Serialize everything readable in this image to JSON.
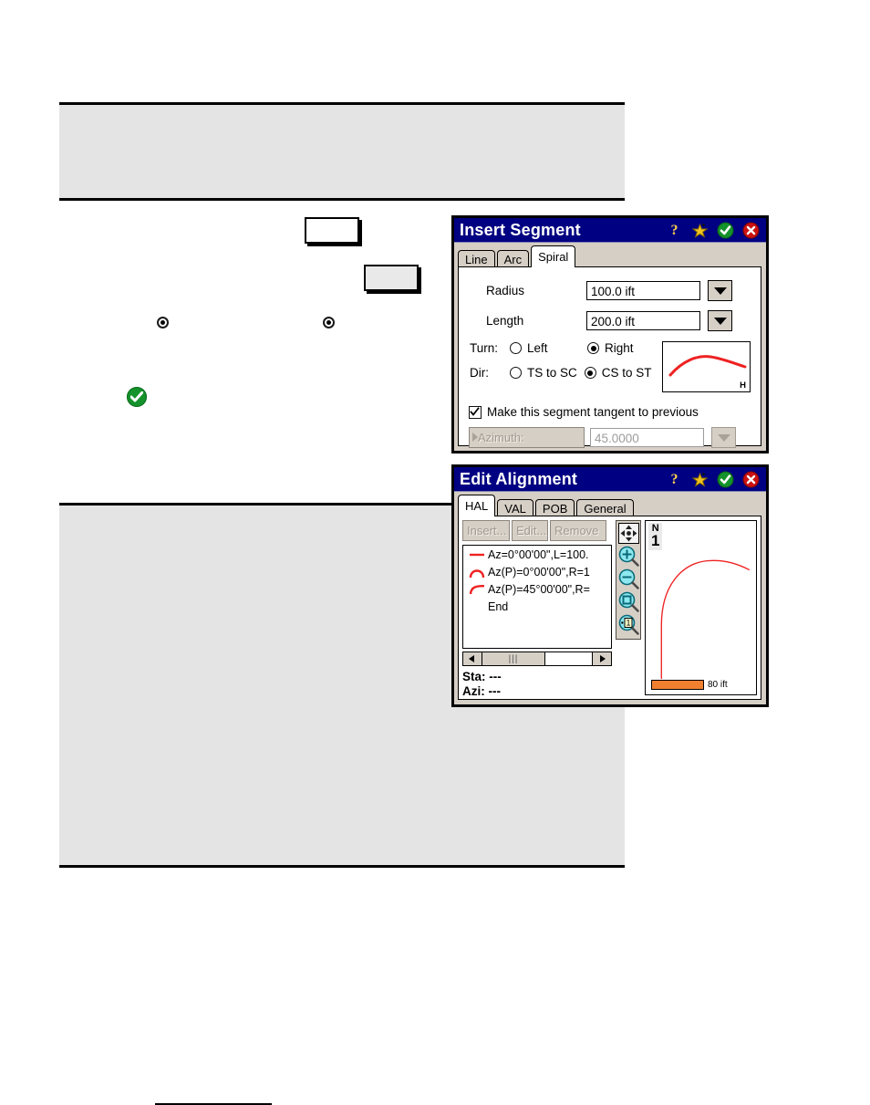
{
  "document": {
    "panels": [
      {
        "name": "top-callout-panel"
      },
      {
        "name": "bottom-callout-panel"
      }
    ]
  },
  "insert_segment": {
    "title": "Insert Segment",
    "titlebar_icons": [
      {
        "name": "help-icon",
        "glyph": "?"
      },
      {
        "name": "favorites-star-icon"
      },
      {
        "name": "ok-check-icon"
      },
      {
        "name": "close-icon"
      }
    ],
    "tabs": [
      {
        "label": "Line",
        "active": false
      },
      {
        "label": "Arc",
        "active": false
      },
      {
        "label": "Spiral",
        "active": true
      }
    ],
    "fields": {
      "radius_label": "Radius",
      "radius_value": "100.0 ift",
      "length_label": "Length",
      "length_value": "200.0 ift"
    },
    "turn": {
      "label": "Turn:",
      "left_label": "Left",
      "right_label": "Right",
      "selected": "Right"
    },
    "dir": {
      "label": "Dir:",
      "ts_to_sc_label": "TS to SC",
      "cs_to_st_label": "CS to ST",
      "selected": "CS to ST"
    },
    "tangent_checkbox": {
      "label": "Make this segment tangent to previous",
      "checked": true
    },
    "azimuth": {
      "label": "Azimuth:",
      "value": "45.0000",
      "disabled": true
    },
    "sketch": {
      "axis_label": "H"
    }
  },
  "edit_alignment": {
    "title": "Edit Alignment",
    "titlebar_icons": [
      {
        "name": "help-icon",
        "glyph": "?"
      },
      {
        "name": "favorites-star-icon"
      },
      {
        "name": "ok-check-icon"
      },
      {
        "name": "close-icon"
      }
    ],
    "tabs": [
      {
        "label": "HAL",
        "active": true
      },
      {
        "label": "VAL",
        "active": false
      },
      {
        "label": "POB",
        "active": false
      },
      {
        "label": "General",
        "active": false
      }
    ],
    "buttons": [
      {
        "label": "Insert...",
        "disabled": true
      },
      {
        "label": "Edit...",
        "disabled": true
      },
      {
        "label": "Remove",
        "disabled": true
      }
    ],
    "segments": [
      {
        "glyph": "line",
        "text": "Az=0°00'00\",L=100."
      },
      {
        "glyph": "arc",
        "text": "Az(P)=0°00'00\",R=1"
      },
      {
        "glyph": "spiral",
        "text": "Az(P)=45°00'00\",R="
      },
      {
        "glyph": "none",
        "text": "End"
      }
    ],
    "status": {
      "sta": "Sta: ---",
      "azi": "Azi: ---"
    },
    "zoom_tools": [
      {
        "name": "pan-fit-icon"
      },
      {
        "name": "zoom-in-icon"
      },
      {
        "name": "zoom-out-icon"
      },
      {
        "name": "zoom-extents-icon"
      },
      {
        "name": "zoom-actual-size-icon"
      }
    ],
    "map": {
      "north_label": "N",
      "north_index": "1",
      "scale_label": "80 ift",
      "scale_color": "#f08030",
      "alignment_color": "#ee2222"
    }
  },
  "colors": {
    "titlebar": "#000082",
    "dialog_face": "#d6cfc6",
    "panel_gray": "#e4e4e4",
    "ok_green": "#14922b",
    "close_red": "#cc1111",
    "star_yellow": "#f0c420"
  }
}
